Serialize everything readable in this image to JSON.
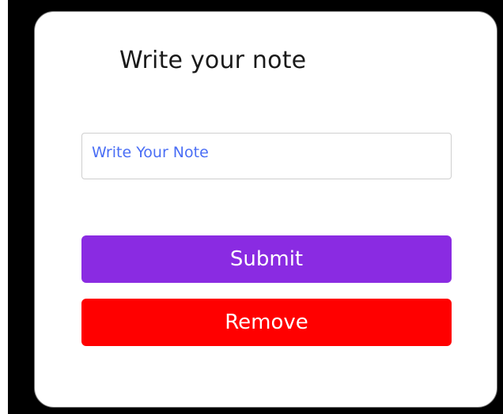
{
  "card": {
    "title": "Write your note",
    "input": {
      "placeholder": "Write Your Note",
      "value": ""
    },
    "submit_label": "Submit",
    "remove_label": "Remove"
  },
  "colors": {
    "background": "#000000",
    "card": "#ffffff",
    "placeholder_text": "#4a6ef5",
    "submit_button": "#8a2be2",
    "remove_button": "#ff0000",
    "button_text": "#ffffff"
  }
}
